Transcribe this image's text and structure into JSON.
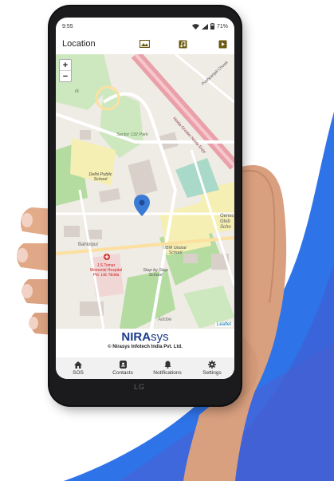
{
  "colors": {
    "accent_blue": "#2f73e8",
    "brand_navy": "#1b3a8a",
    "sos_red": "#d0312d",
    "pin_blue": "#3a7bd5",
    "map_green": "#b4dca0"
  },
  "status": {
    "time": "9:55",
    "battery": "71%"
  },
  "appbar": {
    "title": "Location",
    "icons": [
      "gallery-icon",
      "music-note-icon",
      "play-icon"
    ]
  },
  "map": {
    "zoom_in": "+",
    "zoom_out": "−",
    "labels": {
      "sector": "Sector 132 Park",
      "dps": "Delhi Public School",
      "ibm": "IBM Global School",
      "step": "Step by Step School",
      "bahlolpur": "Bahlolpur",
      "hospital": "J.S.Tomar Memorial Hospital Pvt. Ltd. Noida",
      "road": "Noida-Greater Noida Expy",
      "genesis": "Genes Glob Scho",
      "pushpanjali": "Pushpanjali Chowk",
      "park": "rk",
      "adobe": "Adobe"
    },
    "attribution": "Leaflet"
  },
  "brand": {
    "logo_a": "NIRA",
    "logo_b": "sys",
    "copyright": "© Nirasys Infotech India Pvt. Ltd."
  },
  "nav": [
    {
      "label": "SOS",
      "icon": "home-icon"
    },
    {
      "label": "Contacts",
      "icon": "contacts-icon"
    },
    {
      "label": "Notifications",
      "icon": "bell-icon"
    },
    {
      "label": "Settings",
      "icon": "gear-icon"
    }
  ],
  "phone_brand": "LG"
}
